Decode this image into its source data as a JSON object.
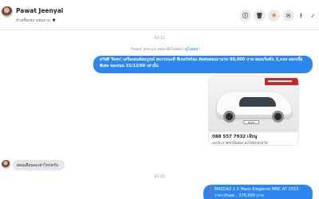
{
  "header": {
    "contact_name": "Pawat Jeenyai",
    "status_text": "ทำเครื่องหมายคนถาม",
    "buttons": [
      {
        "name": "info-icon",
        "glyph": "ⓘ"
      },
      {
        "name": "trash-icon",
        "glyph": "🗑"
      },
      {
        "name": "star-icon",
        "glyph": "★"
      },
      {
        "name": "mail-icon",
        "glyph": "✉"
      },
      {
        "name": "alert-icon",
        "glyph": "!"
      },
      {
        "name": "checkmark-icon",
        "glyph": "✓"
      }
    ]
  },
  "conversation": {
    "timestamp_1": "03:13",
    "system_message": "Pawat Jeenyai ตอบกลับโฆษณา",
    "system_link": "ดูโฆษณา",
    "outgoing_1": "สวัสดี Tom! เครื่องยนต์สมบูรณ์ สมรรถนะดี ฟีเจอร์พร้อม ติดต่อสอบถามรถ 60,000 บาท ผ่อนเริ่มต้น 3,xxx ดอกเบี้ยพิเศษ จองก่อน 31/12/66 เท่านั้น",
    "card_title": "088 557 7932 เจ้บนู",
    "card_subtitle": "ลงประกาศรถมือสอง ลงได้ทุกจังหวัด",
    "plate_text": "MAZ2",
    "incoming_1": "ผ่อนเดือนละเท่าไหร่ครับ",
    "timestamp_2": "03:14",
    "outgoing_2_line1": "📍 MAZDA2 1.5 Maxx Elegance MNC AT 2013",
    "outgoing_2_line2": "📍 ราคาเงินสด : 379,000 บาท"
  }
}
